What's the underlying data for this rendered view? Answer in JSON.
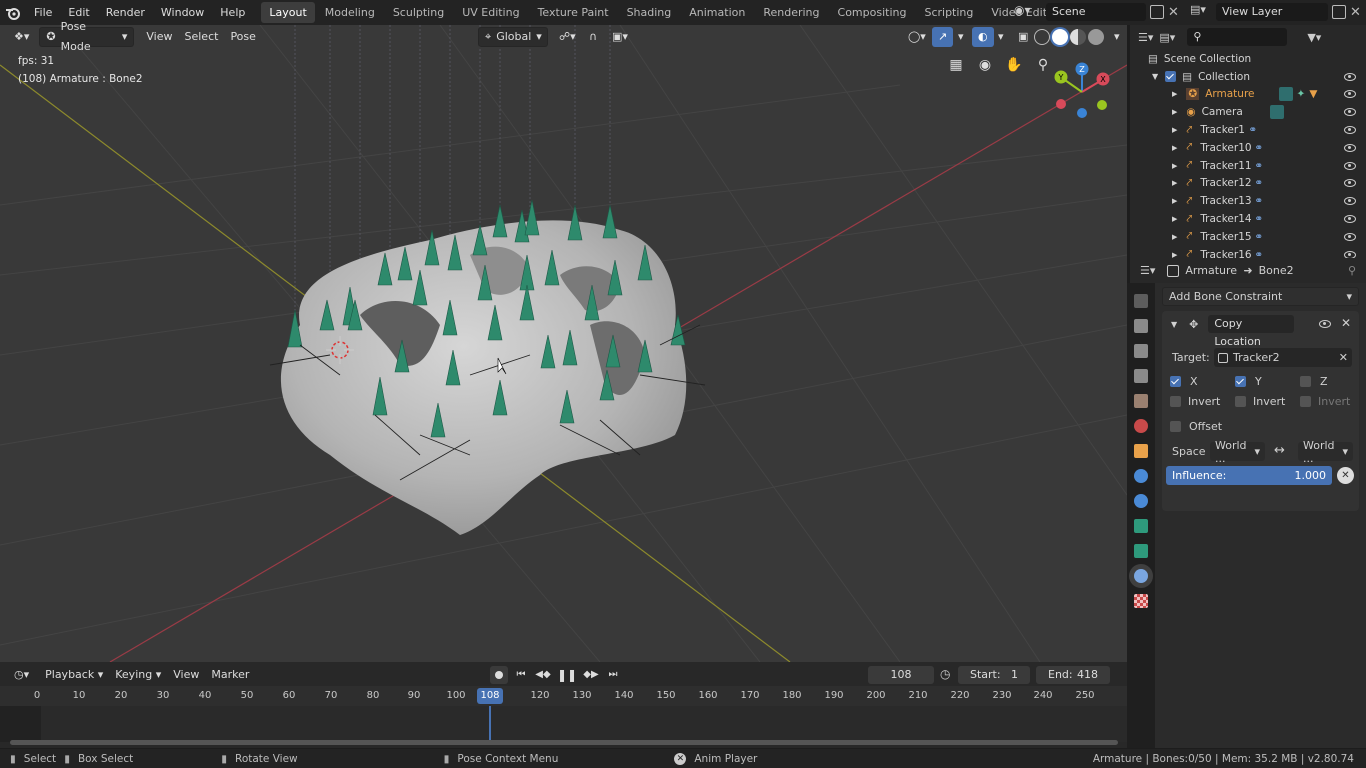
{
  "menus": [
    "File",
    "Edit",
    "Render",
    "Window",
    "Help"
  ],
  "workspaces": [
    "Layout",
    "Modeling",
    "Sculpting",
    "UV Editing",
    "Texture Paint",
    "Shading",
    "Animation",
    "Rendering",
    "Compositing",
    "Scripting",
    "Video Editing"
  ],
  "active_workspace": "Layout",
  "scene": {
    "name": "Scene"
  },
  "view_layer": {
    "name": "View Layer"
  },
  "viewport": {
    "mode": "Pose Mode",
    "menus": [
      "View",
      "Select",
      "Pose"
    ],
    "transform_orientation": "Global",
    "fps": "fps: 31",
    "info": "(108) Armature : Bone2",
    "gizmo": {
      "x": "X",
      "y": "Y",
      "z": "Z"
    }
  },
  "outliner": {
    "scene_collection": "Scene Collection",
    "collection": "Collection",
    "items": [
      "Armature",
      "Camera",
      "Tracker1",
      "Tracker10",
      "Tracker11",
      "Tracker12",
      "Tracker13",
      "Tracker14",
      "Tracker15",
      "Tracker16"
    ]
  },
  "properties": {
    "object": "Armature",
    "bone": "Bone2",
    "add_constraint": "Add Bone Constraint",
    "constraint_name": "Copy Location",
    "target_label": "Target:",
    "target": "Tracker2",
    "axes": {
      "x": "X",
      "y": "Y",
      "z": "Z"
    },
    "invert": "Invert",
    "offset": "Offset",
    "space_label": "Space",
    "space_owner": "World ...",
    "space_target": "World ...",
    "influence_label": "Influence:",
    "influence_value": "1.000",
    "influence": 1.0
  },
  "timeline": {
    "menus": [
      "Playback",
      "Keying",
      "View",
      "Marker"
    ],
    "current_frame": "108",
    "start_label": "Start:",
    "start": "1",
    "end_label": "End:",
    "end": "418",
    "ticks": [
      "0",
      "10",
      "20",
      "30",
      "40",
      "50",
      "60",
      "70",
      "80",
      "90",
      "100",
      "108",
      "120",
      "130",
      "140",
      "150",
      "160",
      "170",
      "180",
      "190",
      "200",
      "210",
      "220",
      "230",
      "240",
      "250"
    ]
  },
  "status": {
    "select": "Select",
    "box_select": "Box Select",
    "rotate_view": "Rotate View",
    "context_menu": "Pose Context Menu",
    "anim_player": "Anim Player",
    "stats": "Armature | Bones:0/50 | Mem: 35.2 MB | v2.80.74"
  },
  "colors": {
    "accent": "#4772b3",
    "active_obj": "#e8a14a",
    "bone": "#2e8a6c",
    "x_axis": "#d84a5a",
    "y_axis": "#9ac520",
    "z_axis": "#3a84d6"
  }
}
